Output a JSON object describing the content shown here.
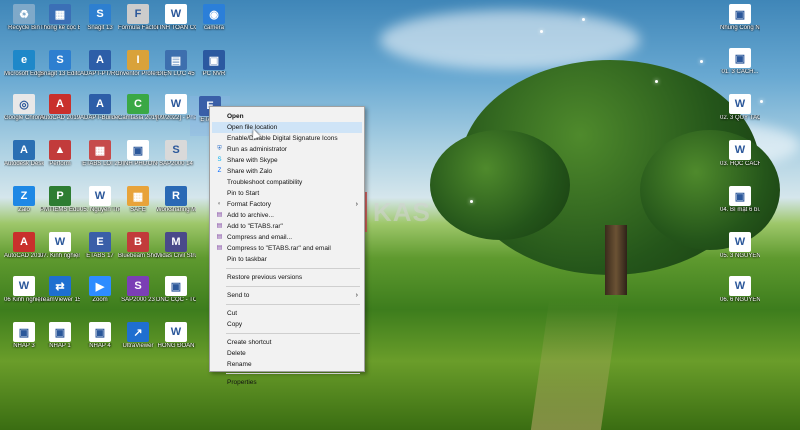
{
  "desktop": {
    "icons": [
      {
        "label": "Recycle Bin",
        "color": "#7fa9c9",
        "glyph": "♻",
        "icon": "recycle-bin-icon"
      },
      {
        "label": "Thống kê cọc ETABS",
        "color": "#3b6fb6",
        "glyph": "▦",
        "icon": "shortcut-icon"
      },
      {
        "label": "Snagit 13",
        "color": "#2d7fd0",
        "glyph": "S",
        "icon": "snagit-icon"
      },
      {
        "label": "Formula Factory",
        "color": "#cccccc",
        "glyph": "F",
        "icon": "app-icon"
      },
      {
        "label": "TÍNH TOÁN CỌC",
        "color": "#ffffff",
        "glyph": "W",
        "icon": "word-doc-icon"
      },
      {
        "label": "camera",
        "color": "#2b7fd9",
        "glyph": "◉",
        "icon": "camera-icon"
      },
      {
        "label": "Microsoft Edge",
        "color": "#1e88c9",
        "glyph": "e",
        "icon": "edge-icon"
      },
      {
        "label": "Snagit 13 Editor",
        "color": "#2d7fd0",
        "glyph": "S",
        "icon": "snagit-editor-icon"
      },
      {
        "label": "ADAPT-PT/RC 2019",
        "color": "#2d5ea8",
        "glyph": "A",
        "icon": "adapt-icon"
      },
      {
        "label": "Inventor Professional 2019",
        "color": "#d9a23a",
        "glyph": "I",
        "icon": "inventor-icon"
      },
      {
        "label": "ĐIỆN LỰC 45",
        "color": "#3d6fae",
        "glyph": "▤",
        "icon": "folder-icon"
      },
      {
        "label": "PC NVR",
        "color": "#2b59a0",
        "glyph": "▣",
        "icon": "nvr-icon"
      },
      {
        "label": "Google Chrome",
        "color": "#e8e8e8",
        "glyph": "◎",
        "icon": "chrome-icon"
      },
      {
        "label": "AutoCAD 2019 - Tiếng",
        "color": "#c9302c",
        "glyph": "A",
        "icon": "autocad-icon"
      },
      {
        "label": "ADAPT-Builder 2019",
        "color": "#2d5ea8",
        "glyph": "A",
        "icon": "adapt-builder-icon"
      },
      {
        "label": "Camtasia 2019",
        "color": "#3aa845",
        "glyph": "C",
        "icon": "camtasia-icon"
      },
      {
        "label": "[09/2022] - Phân mềm",
        "color": "#ffffff",
        "glyph": "W",
        "icon": "word-doc-icon"
      },
      {
        "label": "Adobe Acrobat DC",
        "color": "#d83b2e",
        "glyph": "A",
        "icon": "acrobat-icon"
      },
      {
        "label": "Autodesk Desktop App",
        "color": "#2a6fb3",
        "glyph": "A",
        "icon": "autodesk-icon"
      },
      {
        "label": "Perform",
        "color": "#c23b3b",
        "glyph": "▲",
        "icon": "perform-icon"
      },
      {
        "label": "ETABS LỖI 2",
        "color": "#c64b4b",
        "glyph": "▦",
        "icon": "etabs-icon"
      },
      {
        "label": "ĐỊNH PHƯƠNG Ô NGHE",
        "color": "#ffffff",
        "glyph": "▣",
        "icon": "pdf-icon"
      },
      {
        "label": "SAP2000 14",
        "color": "#d9d9d9",
        "glyph": "S",
        "icon": "sap2000-icon"
      },
      {
        "label": "Revit 2019",
        "color": "#2a69b5",
        "glyph": "R",
        "icon": "revit-icon"
      },
      {
        "label": "Zalo",
        "color": "#1e88e5",
        "glyph": "Z",
        "icon": "zalo-icon"
      },
      {
        "label": "PMTIEMS Education",
        "color": "#2e7d32",
        "glyph": "P",
        "icon": "pmtiems-icon"
      },
      {
        "label": "05. Nguyên Thế Nghiệp",
        "color": "#ffffff",
        "glyph": "W",
        "icon": "word-doc-icon"
      },
      {
        "label": "SAFE",
        "color": "#e8a33a",
        "glyph": "▦",
        "icon": "safe-icon"
      },
      {
        "label": "Worksharing Monitor fo...",
        "color": "#2a69b5",
        "glyph": "R",
        "icon": "revit-monitor-icon"
      },
      {
        "label": "FRP-Analysis",
        "color": "#3a7fc2",
        "glyph": "↗",
        "icon": "frp-icon"
      },
      {
        "label": "AutoCAD 2017 - En...",
        "color": "#c9302c",
        "glyph": "A",
        "icon": "autocad-2017-icon"
      },
      {
        "label": "07. Kinh nghiệm đ...",
        "color": "#ffffff",
        "glyph": "W",
        "icon": "word-doc-icon"
      },
      {
        "label": "ETABS 17",
        "color": "#3a5fa8",
        "glyph": "E",
        "icon": "etabs-17-icon"
      },
      {
        "label": "Bluebeam Shortcut",
        "color": "#c23b3b",
        "glyph": "B",
        "icon": "bluebeam-icon"
      },
      {
        "label": "Midas Civil Structure",
        "color": "#4a4a8a",
        "glyph": "M",
        "icon": "midas-icon"
      },
      {
        "label": "Tiến Chị Ngọc",
        "color": "#c23b3b",
        "glyph": "▣",
        "icon": "pdf-icon"
      },
      {
        "label": "06 Kinh nghiệm chọn",
        "color": "#ffffff",
        "glyph": "W",
        "icon": "word-doc-icon"
      },
      {
        "label": "TeamViewer 15",
        "color": "#1e6fd0",
        "glyph": "⇄",
        "icon": "teamviewer-icon"
      },
      {
        "label": "Zoom",
        "color": "#2d8cff",
        "glyph": "▶",
        "icon": "zoom-icon"
      },
      {
        "label": "SAP2000 23",
        "color": "#7b3fb5",
        "glyph": "S",
        "icon": "sap2000-23-icon"
      },
      {
        "label": "DNC CỌC - TỔNG HỢP",
        "color": "#ffffff",
        "glyph": "▣",
        "icon": "pdf-icon"
      },
      {
        "label": "CÓ NHỮNG",
        "color": "#ffffff",
        "glyph": "W",
        "icon": "word-doc-icon"
      },
      {
        "label": "NHAP 3",
        "color": "#ffffff",
        "glyph": "▣",
        "icon": "pdf-icon"
      },
      {
        "label": "NHAP 1",
        "color": "#ffffff",
        "glyph": "▣",
        "icon": "pdf-icon"
      },
      {
        "label": "NHAP 4",
        "color": "#ffffff",
        "glyph": "▣",
        "icon": "pdf-icon"
      },
      {
        "label": "UltraViewer",
        "color": "#1f6fd0",
        "glyph": "↗",
        "icon": "ultraviewer-icon"
      },
      {
        "label": "HỒNG ĐOÀN",
        "color": "#ffffff",
        "glyph": "W",
        "icon": "word-doc-icon"
      }
    ],
    "right_icons": [
      {
        "label": "Nhung Cong Nghe Sac Th...",
        "color": "#ffffff",
        "glyph": "▣",
        "icon": "pdf-icon"
      },
      {
        "label": "01. 3 CÁCH...",
        "color": "#ffffff",
        "glyph": "▣",
        "icon": "pdf-icon"
      },
      {
        "label": "02. 3 QUY TẮC NGÀNH",
        "color": "#ffffff",
        "glyph": "W",
        "icon": "word-doc-icon"
      },
      {
        "label": "03. HỌC CÁCH KẾ",
        "color": "#ffffff",
        "glyph": "W",
        "icon": "word-doc-icon"
      },
      {
        "label": "04. Bí mật 6 bí...",
        "color": "#ffffff",
        "glyph": "▣",
        "icon": "pdf-icon"
      },
      {
        "label": "05. 3 NGUYÊN T...",
        "color": "#ffffff",
        "glyph": "W",
        "icon": "word-doc-icon"
      },
      {
        "label": "06. 6 NGUYÊN T...",
        "color": "#ffffff",
        "glyph": "W",
        "icon": "word-doc-icon"
      }
    ],
    "selected_icon": {
      "label": "ETABS",
      "color": "#3a5fa8",
      "glyph": "E",
      "icon": "etabs-selected-icon"
    },
    "watermark": {
      "letter": "K",
      "text": "KAS"
    }
  },
  "context_menu": {
    "items": [
      {
        "type": "item",
        "label": "Open",
        "icon": "",
        "bold": true
      },
      {
        "type": "item",
        "label": "Open file location",
        "icon": "",
        "highlight": true
      },
      {
        "type": "item",
        "label": "Enable/Disable Digital Signature Icons",
        "icon": ""
      },
      {
        "type": "item",
        "label": "Run as administrator",
        "icon": "shield-icon",
        "glyph": "⛨",
        "color": "#2c6fc9"
      },
      {
        "type": "item",
        "label": "Share with Skype",
        "icon": "skype-icon",
        "glyph": "S",
        "color": "#00aff0"
      },
      {
        "type": "item",
        "label": "Share with Zalo",
        "icon": "zalo-icon",
        "glyph": "Z",
        "color": "#0068ff"
      },
      {
        "type": "item",
        "label": "Troubleshoot compatibility",
        "icon": ""
      },
      {
        "type": "item",
        "label": "Pin to Start",
        "icon": ""
      },
      {
        "type": "item",
        "label": "Format Factory",
        "icon": "format-factory-icon",
        "glyph": "◐",
        "color": "#888888",
        "submenu": true
      },
      {
        "type": "item",
        "label": "Add to archive...",
        "icon": "winrar-icon",
        "glyph": "▤",
        "color": "#7a3b9f"
      },
      {
        "type": "item",
        "label": "Add to \"ETABS.rar\"",
        "icon": "winrar-icon",
        "glyph": "▤",
        "color": "#7a3b9f"
      },
      {
        "type": "item",
        "label": "Compress and email...",
        "icon": "winrar-icon",
        "glyph": "▤",
        "color": "#7a3b9f"
      },
      {
        "type": "item",
        "label": "Compress to \"ETABS.rar\" and email",
        "icon": "winrar-icon",
        "glyph": "▤",
        "color": "#7a3b9f"
      },
      {
        "type": "item",
        "label": "Pin to taskbar",
        "icon": ""
      },
      {
        "type": "sep"
      },
      {
        "type": "item",
        "label": "Restore previous versions",
        "icon": ""
      },
      {
        "type": "sep"
      },
      {
        "type": "item",
        "label": "Send to",
        "icon": "",
        "submenu": true
      },
      {
        "type": "sep"
      },
      {
        "type": "item",
        "label": "Cut",
        "icon": ""
      },
      {
        "type": "item",
        "label": "Copy",
        "icon": ""
      },
      {
        "type": "sep"
      },
      {
        "type": "item",
        "label": "Create shortcut",
        "icon": ""
      },
      {
        "type": "item",
        "label": "Delete",
        "icon": ""
      },
      {
        "type": "item",
        "label": "Rename",
        "icon": ""
      },
      {
        "type": "sep"
      },
      {
        "type": "item",
        "label": "Properties",
        "icon": ""
      }
    ]
  }
}
